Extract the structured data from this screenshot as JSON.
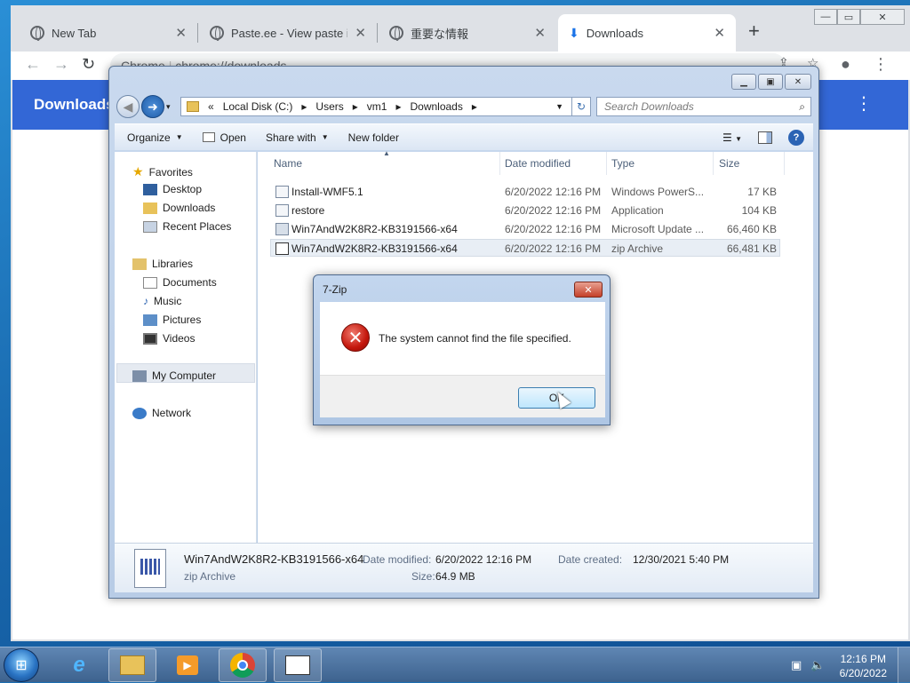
{
  "chrome": {
    "tabs": [
      {
        "title": "New Tab",
        "icon": "chrome-icon"
      },
      {
        "title": "Paste.ee - View paste ihXk",
        "icon": "globe-icon"
      },
      {
        "title": "重要な情報",
        "icon": "globe-icon"
      },
      {
        "title": "Downloads",
        "icon": "download-icon"
      }
    ],
    "omnibox_site": "Chrome",
    "omnibox_url": "chrome://downloads",
    "page_title": "Downloads"
  },
  "explorer": {
    "breadcrumb": [
      "Local Disk (C:)",
      "Users",
      "vm1",
      "Downloads"
    ],
    "search_placeholder": "Search Downloads",
    "commands": {
      "organize": "Organize",
      "open": "Open",
      "share": "Share with",
      "new_folder": "New folder"
    },
    "nav": {
      "favorites": "Favorites",
      "desktop": "Desktop",
      "downloads": "Downloads",
      "recent": "Recent Places",
      "libraries": "Libraries",
      "documents": "Documents",
      "music": "Music",
      "pictures": "Pictures",
      "videos": "Videos",
      "computer": "My Computer",
      "network": "Network"
    },
    "columns": {
      "name": "Name",
      "date": "Date modified",
      "type": "Type",
      "size": "Size"
    },
    "files": [
      {
        "name": "Install-WMF5.1",
        "date": "6/20/2022 12:16 PM",
        "type": "Windows PowerS...",
        "size": "17 KB"
      },
      {
        "name": "restore",
        "date": "6/20/2022 12:16 PM",
        "type": "Application",
        "size": "104 KB"
      },
      {
        "name": "Win7AndW2K8R2-KB3191566-x64",
        "date": "6/20/2022 12:16 PM",
        "type": "Microsoft Update ...",
        "size": "66,460 KB"
      },
      {
        "name": "Win7AndW2K8R2-KB3191566-x64",
        "date": "6/20/2022 12:16 PM",
        "type": "zip Archive",
        "size": "66,481 KB"
      }
    ],
    "details": {
      "name": "Win7AndW2K8R2-KB3191566-x64",
      "type": "zip Archive",
      "modified_label": "Date modified:",
      "modified": "6/20/2022 12:16 PM",
      "size_label": "Size:",
      "size": "64.9 MB",
      "created_label": "Date created:",
      "created": "12/30/2021 5:40 PM"
    }
  },
  "dialog": {
    "title": "7-Zip",
    "message": "The system cannot find the file specified.",
    "ok": "OK"
  },
  "taskbar": {
    "time": "12:16 PM",
    "date": "6/20/2022",
    "apps": [
      "ie-icon",
      "explorer-icon",
      "media-player-icon",
      "chrome-icon",
      "7zip-icon"
    ]
  }
}
